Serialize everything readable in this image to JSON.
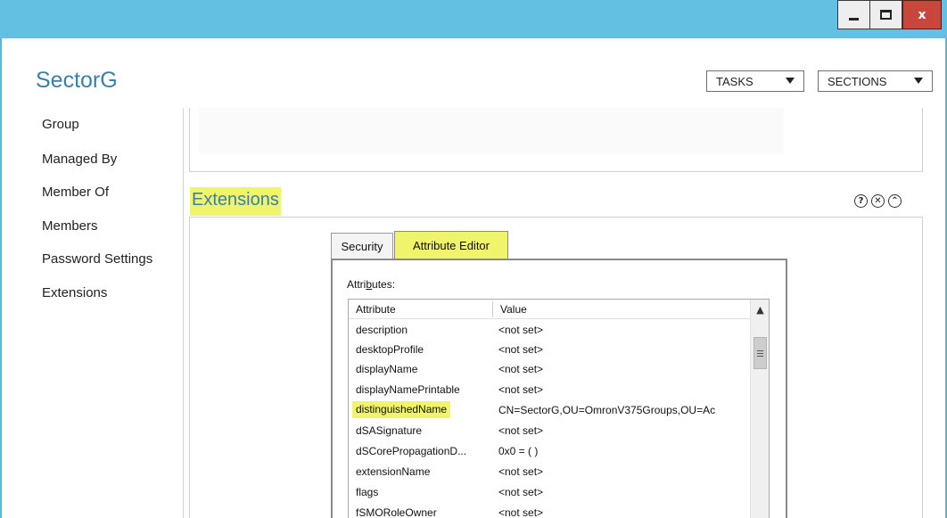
{
  "window": {
    "close_label": "x"
  },
  "header": {
    "title": "SectorG",
    "tasks_label": "TASKS",
    "sections_label": "SECTIONS"
  },
  "sidebar": {
    "items": [
      {
        "label": "Group"
      },
      {
        "label": "Managed By"
      },
      {
        "label": "Member Of"
      },
      {
        "label": "Members"
      },
      {
        "label": "Password Settings"
      },
      {
        "label": "Extensions"
      }
    ]
  },
  "extensions": {
    "heading": "Extensions",
    "icons": [
      "help-icon",
      "close-icon",
      "collapse-icon"
    ],
    "help_glyph": "?",
    "close_glyph": "✕",
    "collapse_glyph": "⌃",
    "tabs": [
      {
        "label": "Security",
        "selected": false
      },
      {
        "label": "Attribute Editor",
        "selected": true
      }
    ],
    "attributes_label_pre": "Attri",
    "attributes_label_u": "b",
    "attributes_label_post": "utes:",
    "columns": {
      "attribute": "Attribute",
      "value": "Value"
    },
    "rows": [
      {
        "attribute": "description",
        "value": "<not set>"
      },
      {
        "attribute": "desktopProfile",
        "value": "<not set>"
      },
      {
        "attribute": "displayName",
        "value": "<not set>"
      },
      {
        "attribute": "displayNamePrintable",
        "value": "<not set>"
      },
      {
        "attribute": "distinguishedName",
        "value": "CN=SectorG,OU=OmronV375Groups,OU=Ac"
      },
      {
        "attribute": "dSASignature",
        "value": "<not set>"
      },
      {
        "attribute": "dSCorePropagationD...",
        "value": "0x0 = ( )"
      },
      {
        "attribute": "extensionName",
        "value": "<not set>"
      },
      {
        "attribute": "flags",
        "value": "<not set>"
      },
      {
        "attribute": "fSMORoleOwner",
        "value": "<not set>"
      }
    ],
    "highlighted_row": 4
  },
  "colors": {
    "accent": "#3b7fa8",
    "titlebar": "#62c1e2",
    "highlight": "#f0f46a",
    "close_button": "#c8463c"
  }
}
